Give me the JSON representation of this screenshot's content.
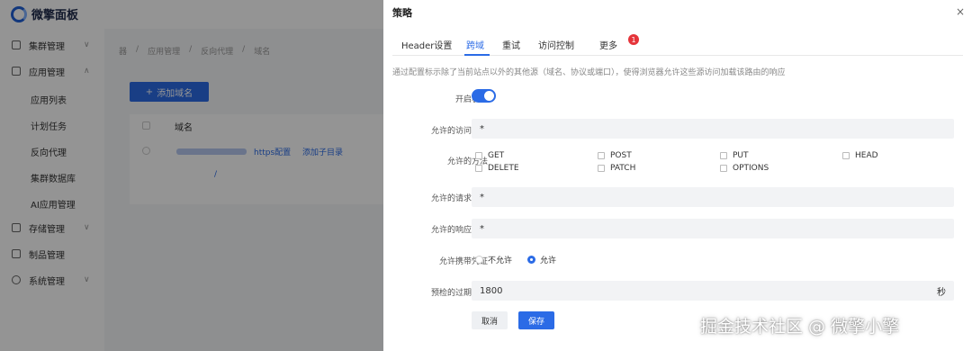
{
  "app": {
    "logo_text": "微擎面板",
    "sidebar": {
      "groups": [
        {
          "label": "集群管理",
          "icon": "cluster-icon",
          "chevron": "∨"
        },
        {
          "label": "应用管理",
          "icon": "apps-icon",
          "chevron": "∧"
        },
        {
          "label": "存储管理",
          "icon": "storage-icon",
          "chevron": "∨"
        },
        {
          "label": "制品管理",
          "icon": "artifact-icon",
          "chevron": ""
        },
        {
          "label": "系统管理",
          "icon": "cloud-icon",
          "chevron": "∨"
        }
      ],
      "app_sub_items": [
        "应用列表",
        "计划任务",
        "反向代理",
        "集群数据库",
        "AI应用管理"
      ]
    },
    "breadcrumb": [
      "器",
      "应用管理",
      "反向代理",
      "域名"
    ],
    "add_button": "添加域名",
    "table": {
      "header_domain": "域名",
      "row": {
        "link1": "https配置",
        "link2": "添加子目录",
        "sub": "/"
      }
    }
  },
  "drawer": {
    "title": "策略",
    "close": "×",
    "tabs": [
      {
        "label": "Header设置",
        "active": false
      },
      {
        "label": "跨域",
        "active": true
      },
      {
        "label": "重试",
        "active": false
      },
      {
        "label": "访问控制",
        "active": false
      },
      {
        "label": "更多",
        "active": false
      }
    ],
    "more_badge": "1",
    "description": "通过配置标示除了当前站点以外的其他源（域名、协议或端口），使得浏览器允许这些源访问加载该路由的响应",
    "form": {
      "enable_label": "开启状态",
      "enabled": true,
      "origins_label": "允许的访问来源",
      "origins_value": "*",
      "methods_label": "允许的方法",
      "methods": [
        "GET",
        "POST",
        "PUT",
        "HEAD",
        "DELETE",
        "PATCH",
        "OPTIONS"
      ],
      "req_headers_label": "允许的请求头部",
      "req_headers_value": "*",
      "resp_headers_label": "允许的响应头部",
      "resp_headers_value": "*",
      "credentials_label": "允许携带凭证",
      "credentials_options": [
        "不允许",
        "允许"
      ],
      "credentials_selected": "允许",
      "maxage_label": "预检的过期时间",
      "maxage_value": "1800",
      "maxage_unit": "秒"
    },
    "buttons": {
      "cancel": "取消",
      "save": "保存"
    }
  },
  "watermark": "掘金技术社区 @ 微擎小擎",
  "colors": {
    "accent": "#2b6be6",
    "badge": "#e5343a"
  }
}
